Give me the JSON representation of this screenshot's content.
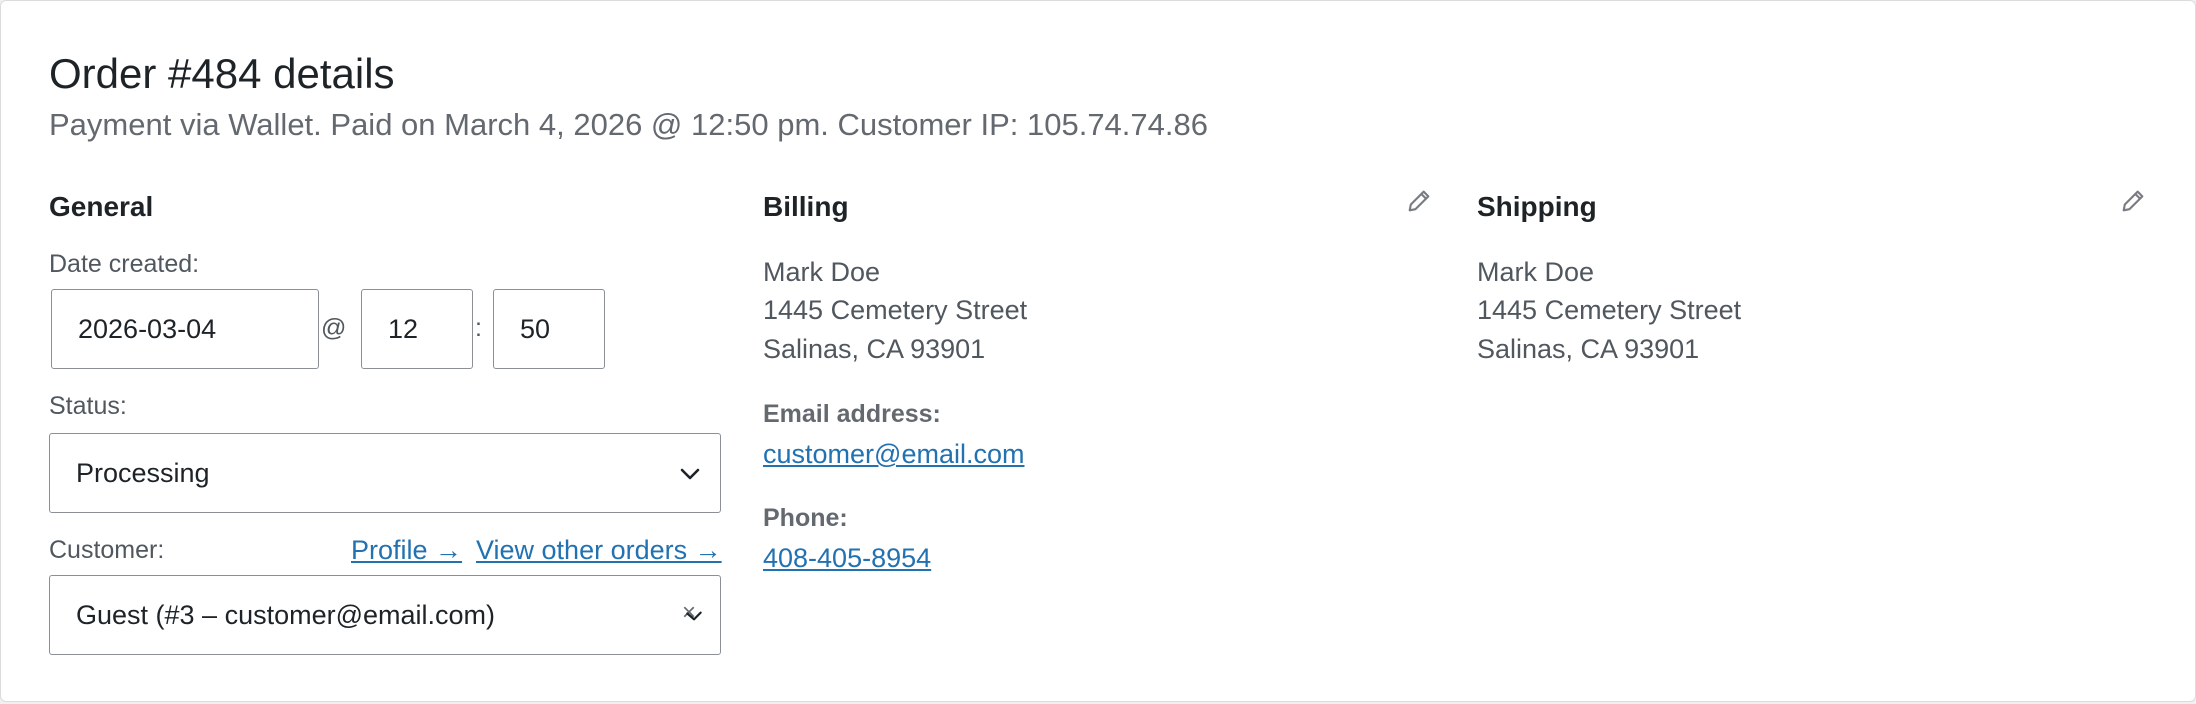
{
  "order": {
    "title": "Order #484 details",
    "subtitle": "Payment via Wallet. Paid on March 4, 2026 @ 12:50 pm. Customer IP: 105.74.74.86"
  },
  "general": {
    "heading": "General",
    "date_created_label": "Date created:",
    "date_value": "2026-03-04",
    "at_symbol": "@",
    "hour_value": "12",
    "colon": ":",
    "minute_value": "50",
    "status_label": "Status:",
    "status_value": "Processing",
    "customer_label": "Customer:",
    "profile_link": "Profile →",
    "view_orders_link": "View other orders →",
    "customer_value": "Guest (#3 – customer@email.com)",
    "clear_symbol": "×"
  },
  "billing": {
    "heading": "Billing",
    "name": "Mark Doe",
    "street": "1445 Cemetery Street",
    "city_line": "Salinas, CA 93901",
    "email_label": "Email address:",
    "email": "customer@email.com",
    "phone_label": "Phone:",
    "phone": "408-405-8954",
    "edit_icon": "pencil-icon"
  },
  "shipping": {
    "heading": "Shipping",
    "name": "Mark Doe",
    "street": "1445 Cemetery Street",
    "city_line": "Salinas, CA 93901",
    "edit_icon": "pencil-icon"
  },
  "colors": {
    "link": "#2271b1",
    "border": "#8c8f94",
    "muted_text": "#646970"
  }
}
